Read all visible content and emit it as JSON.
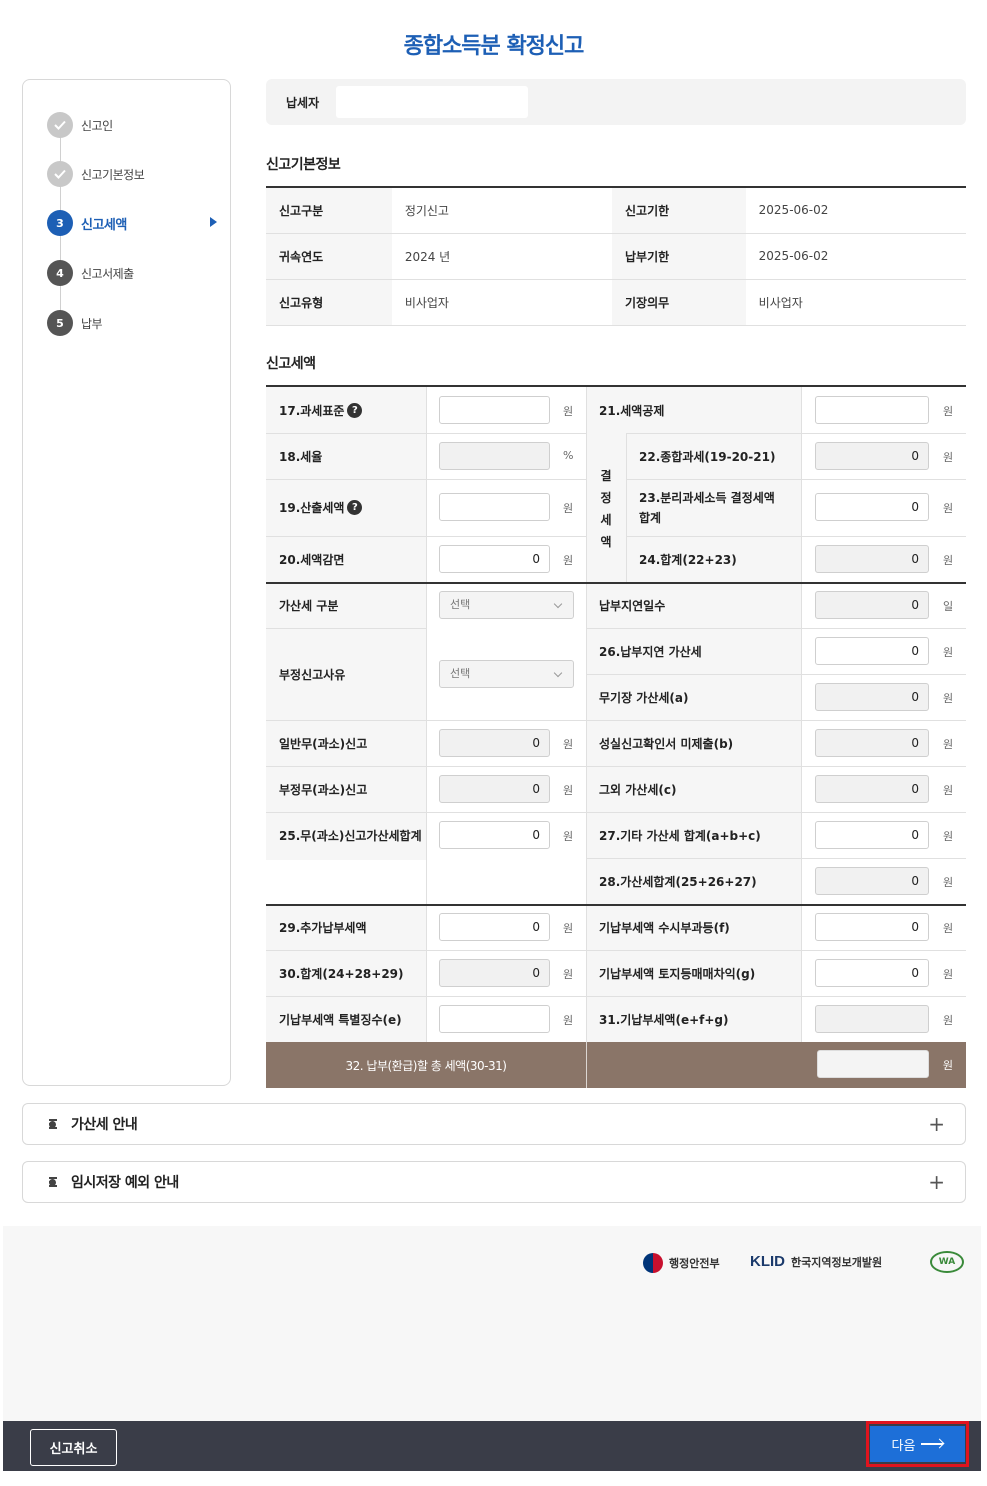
{
  "page": {
    "title": "종합소득분 확정신고"
  },
  "steps": [
    {
      "num": "",
      "label": "신고인",
      "state": "done"
    },
    {
      "num": "",
      "label": "신고기본정보",
      "state": "done"
    },
    {
      "num": "3",
      "label": "신고세액",
      "state": "active"
    },
    {
      "num": "4",
      "label": "신고서제출",
      "state": "todo"
    },
    {
      "num": "5",
      "label": "납부",
      "state": "todo"
    }
  ],
  "taxpayer": {
    "label": "납세자",
    "value": ""
  },
  "basic": {
    "title": "신고기본정보",
    "report_type_label": "신고구분",
    "report_type": "정기신고",
    "deadline_label": "신고기한",
    "deadline": "2025-06-02",
    "year_label": "귀속연도",
    "year": "2024 년",
    "pay_deadline_label": "납부기한",
    "pay_deadline": "2025-06-02",
    "report_kind_label": "신고유형",
    "report_kind": "비사업자",
    "bookkeeping_label": "기장의무",
    "bookkeeping": "비사업자"
  },
  "tax": {
    "title": "신고세액",
    "f17": {
      "label": "17.과세표준",
      "value": "",
      "unit": "원"
    },
    "f18": {
      "label": "18.세율",
      "value": "",
      "unit": "%"
    },
    "f19": {
      "label": "19.산출세액",
      "value": "",
      "unit": "원"
    },
    "f20": {
      "label": "20.세액감면",
      "value": "0",
      "unit": "원"
    },
    "f21": {
      "label": "21.세액공제",
      "value": "",
      "unit": "원"
    },
    "vertical": "결정세액",
    "f22": {
      "label": "22.종합과세(19-20-21)",
      "value": "0",
      "unit": "원"
    },
    "f23": {
      "label": "23.분리과세소득 결정세액 합계",
      "value": "0",
      "unit": "원"
    },
    "f24": {
      "label": "24.합계(22+23)",
      "value": "0",
      "unit": "원"
    },
    "penalty_type": {
      "label": "가산세 구분",
      "value": "선택"
    },
    "fraud_reason": {
      "label": "부정신고사유",
      "value": "선택"
    },
    "late_days": {
      "label": "납부지연일수",
      "value": "0",
      "unit": "일"
    },
    "f26": {
      "label": "26.납부지연 가산세",
      "value": "0",
      "unit": "원"
    },
    "fa": {
      "label": "무기장 가산세(a)",
      "value": "0",
      "unit": "원"
    },
    "general_under": {
      "label": "일반무(과소)신고",
      "value": "0",
      "unit": "원"
    },
    "fb": {
      "label": "성실신고확인서 미제출(b)",
      "value": "0",
      "unit": "원"
    },
    "fraud_under": {
      "label": "부정무(과소)신고",
      "value": "0",
      "unit": "원"
    },
    "fc": {
      "label": "그외 가산세(c)",
      "value": "0",
      "unit": "원"
    },
    "f25": {
      "label": "25.무(과소)신고가산세합계",
      "value": "0",
      "unit": "원"
    },
    "f27": {
      "label": "27.기타 가산세 합계(a+b+c)",
      "value": "0",
      "unit": "원"
    },
    "f28": {
      "label": "28.가산세합계(25+26+27)",
      "value": "0",
      "unit": "원"
    },
    "f29": {
      "label": "29.추가납부세액",
      "value": "0",
      "unit": "원"
    },
    "ff": {
      "label": "기납부세액 수시부과등(f)",
      "value": "0",
      "unit": "원"
    },
    "f30": {
      "label": "30.합계(24+28+29)",
      "value": "0",
      "unit": "원"
    },
    "fg": {
      "label": "기납부세액 토지등매매차익(g)",
      "value": "0",
      "unit": "원"
    },
    "fe": {
      "label": "기납부세액 특별징수(e)",
      "value": "",
      "unit": "원"
    },
    "f31": {
      "label": "31.기납부세액(e+f+g)",
      "value": "",
      "unit": "원"
    },
    "f32": {
      "label": "32. 납부(환급)할 총 세액(30-31)",
      "value": "",
      "unit": "원"
    },
    "help": "?"
  },
  "accordions": {
    "penalty_guide": "가산세 안내",
    "temp_save_guide": "임시저장 예외 안내",
    "expand_symbol": "+"
  },
  "footer": {
    "mois": "행정안전부",
    "klid": "KLID",
    "klid_name": "한국지역정보개발원",
    "wa": "WA"
  },
  "actions": {
    "cancel": "신고취소",
    "next": "다음"
  }
}
